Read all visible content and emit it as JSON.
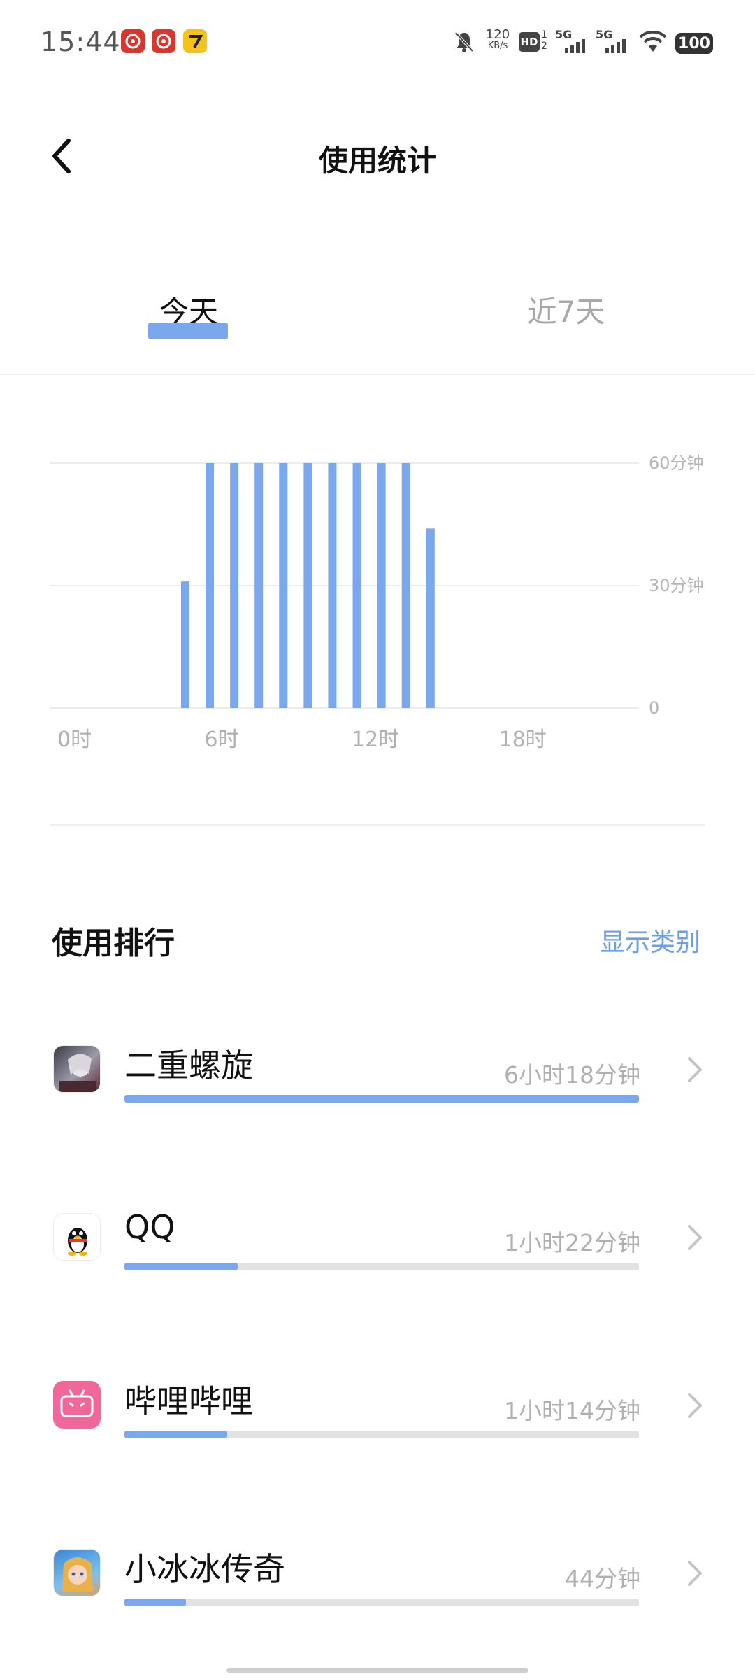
{
  "status_bar": {
    "time": "15:44",
    "app_icons": [
      "netease-music-icon",
      "netease-music-icon",
      "qimao-novel-icon"
    ],
    "net_speed_value": "120",
    "net_speed_unit": "KB/s",
    "hd_label": "HD",
    "sim1_label": "5G",
    "sim2_label": "5G",
    "battery": "100"
  },
  "header": {
    "title": "使用统计",
    "back_icon": "chevron-left-icon"
  },
  "tabs": [
    {
      "label": "今天",
      "active": true
    },
    {
      "label": "近7天",
      "active": false
    }
  ],
  "chart_data": {
    "type": "bar",
    "x_tick_labels": [
      "0时",
      "6时",
      "12时",
      "18时"
    ],
    "y_tick_labels": [
      "60分钟",
      "30分钟",
      "0"
    ],
    "ylim": [
      0,
      60
    ],
    "grid": true,
    "categories": [
      "0",
      "1",
      "2",
      "3",
      "4",
      "5",
      "6",
      "7",
      "8",
      "9",
      "10",
      "11",
      "12",
      "13",
      "14",
      "15",
      "16",
      "17",
      "18",
      "19",
      "20",
      "21",
      "22",
      "23"
    ],
    "values": [
      0,
      0,
      0,
      0,
      0,
      31,
      60,
      60,
      60,
      60,
      60,
      60,
      60,
      60,
      60,
      44,
      0,
      0,
      0,
      0,
      0,
      0,
      0,
      0
    ],
    "color": "#7aa7ee"
  },
  "ranking": {
    "title": "使用排行",
    "show_category_label": "显示类别",
    "apps": [
      {
        "name": "二重螺旋",
        "time": "6小时18分钟",
        "fraction": 1.0,
        "icon": "game-character-icon"
      },
      {
        "name": "QQ",
        "time": "1小时22分钟",
        "fraction": 0.22,
        "icon": "qq-penguin-icon"
      },
      {
        "name": "哔哩哔哩",
        "time": "1小时14分钟",
        "fraction": 0.2,
        "icon": "bilibili-icon"
      },
      {
        "name": "小冰冰传奇",
        "time": "44分钟",
        "fraction": 0.12,
        "icon": "game-girl-icon"
      }
    ]
  },
  "colors": {
    "accent": "#7aa7ee",
    "link": "#6e9de8",
    "muted_text": "#b0b0b0"
  }
}
